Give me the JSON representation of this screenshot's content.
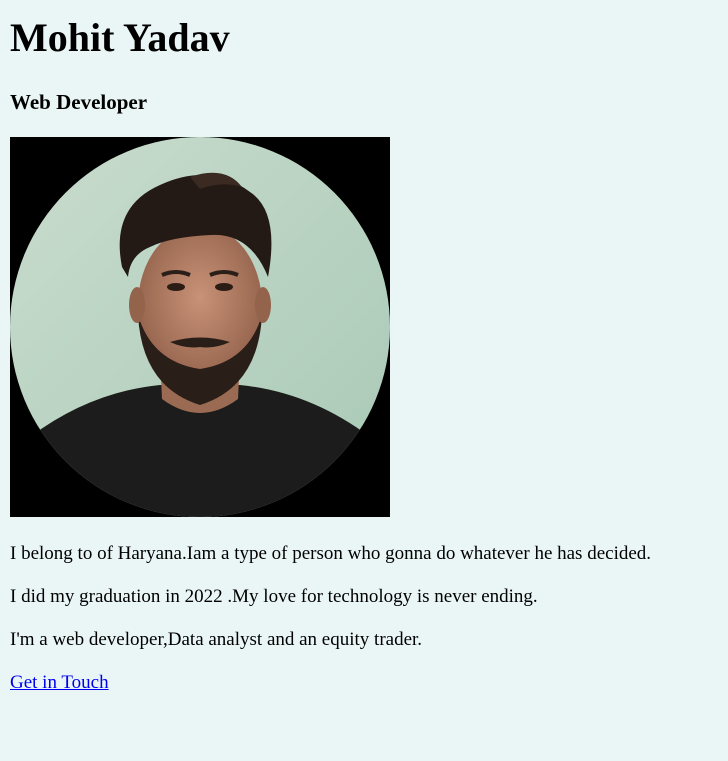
{
  "profile": {
    "name": "Mohit Yadav",
    "role": "Web Developer",
    "photo_icon": "profile-photo"
  },
  "bio": {
    "line1": "I belong to of Haryana.Iam a type of person who gonna do whatever he has decided.",
    "line2": "I did my graduation in 2022 .My love for technology is never ending.",
    "line3": "I'm a web developer,Data analyst and an equity trader."
  },
  "contact": {
    "link_label": "Get in Touch"
  },
  "colors": {
    "background": "#eaf6f6",
    "link": "#0000ee"
  }
}
